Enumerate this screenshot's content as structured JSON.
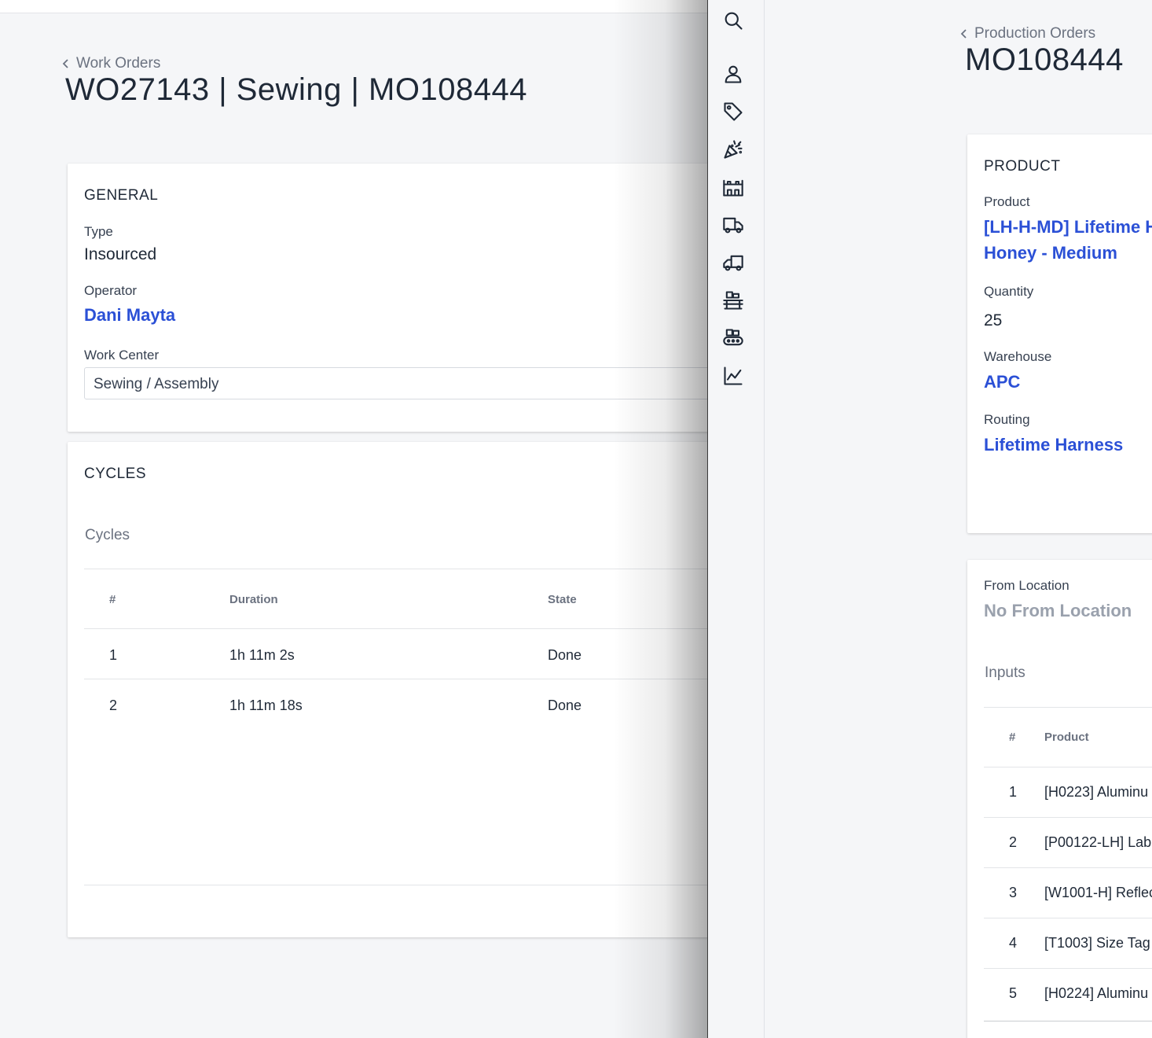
{
  "work_order": {
    "back_label": "Work Orders",
    "title": "WO27143 | Sewing | MO108444",
    "general": {
      "title": "GENERAL",
      "type_label": "Type",
      "type_value": "Insourced",
      "operator_label": "Operator",
      "operator_value": "Dani Mayta",
      "work_center_label": "Work Center",
      "work_center_value": "Sewing / Assembly"
    },
    "cycles": {
      "title": "CYCLES",
      "subheading": "Cycles",
      "columns": [
        "#",
        "Duration",
        "State"
      ],
      "rows": [
        {
          "num": "1",
          "duration": "1h 11m 2s",
          "state": "Done"
        },
        {
          "num": "2",
          "duration": "1h 11m 18s",
          "state": "Done"
        }
      ]
    }
  },
  "rail_icons": [
    "search-icon",
    "user-icon",
    "tag-icon",
    "party-popper-icon",
    "factory-icon",
    "truck-icon",
    "truck-reverse-icon",
    "assembly-line-icon",
    "conveyor-icon",
    "chart-line-icon"
  ],
  "production_order": {
    "back_label": "Production Orders",
    "title": "MO108444",
    "product_card": {
      "title": "PRODUCT",
      "product_label": "Product",
      "product_line1": "[LH-H-MD] Lifetime H",
      "product_line2": "Honey - Medium",
      "quantity_label": "Quantity",
      "quantity_value": "25",
      "warehouse_label": "Warehouse",
      "warehouse_value": "APC",
      "routing_label": "Routing",
      "routing_value": "Lifetime Harness"
    },
    "inputs_card": {
      "from_location_label": "From Location",
      "from_location_value": "No From Location",
      "subheading": "Inputs",
      "columns": [
        "#",
        "Product"
      ],
      "rows": [
        {
          "num": "1",
          "product": "[H0223] Aluminu"
        },
        {
          "num": "2",
          "product": "[P00122-LH] Lab"
        },
        {
          "num": "3",
          "product": "[W1001-H] Reflec"
        },
        {
          "num": "4",
          "product": "[T1003] Size Tag"
        },
        {
          "num": "5",
          "product": "[H0224] Aluminu"
        }
      ]
    }
  },
  "colors": {
    "link": "#2b50d6",
    "background": "#f5f6f8",
    "muted": "#9aa1ad"
  }
}
